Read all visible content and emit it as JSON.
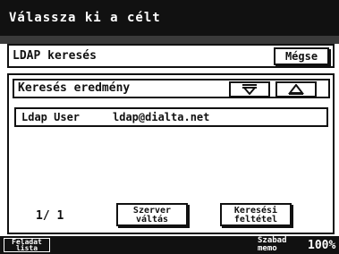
{
  "title": "Válassza ki a célt",
  "ldap_search": {
    "label": "LDAP keresés",
    "cancel_label": "Mégse"
  },
  "results": {
    "header": "Keresés eredmény",
    "rows": [
      {
        "name": "Ldap User",
        "email": "ldap@dialta.net"
      }
    ],
    "page_counter": "1/ 1",
    "server_switch_line1": "Szerver",
    "server_switch_line2": "váltás",
    "criteria_line1": "Keresési",
    "criteria_line2": "feltétel"
  },
  "status_bar": {
    "job_line1": "Feladat",
    "job_line2": "lista",
    "free_line1": "Szabad",
    "free_line2": "memo",
    "free_percent": "100%"
  },
  "icons": {
    "scroll_down": "triangle-down-icon",
    "scroll_up": "triangle-up-icon"
  },
  "colors": {
    "title_bg": "#111111",
    "title_fg": "#ffffff",
    "panel_bg": "#ffffff",
    "border": "#111111"
  }
}
